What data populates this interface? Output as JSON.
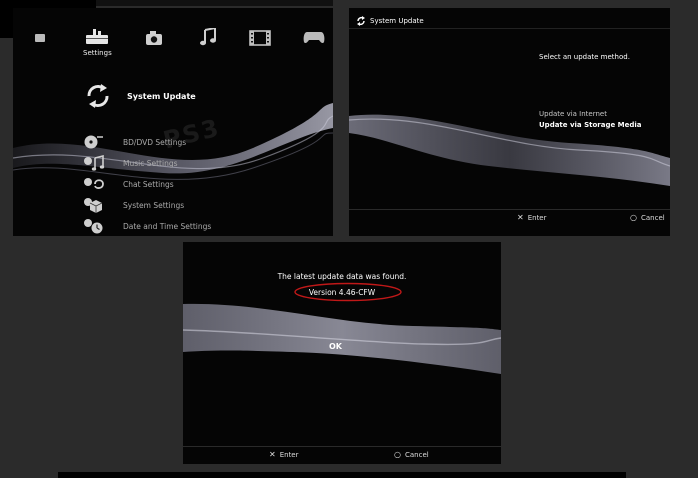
{
  "xmb": {
    "category_label": "Settings",
    "items": [
      {
        "label": "System Update",
        "selected": true
      },
      {
        "label": "BD/DVD Settings"
      },
      {
        "label": "Music Settings"
      },
      {
        "label": "Chat Settings"
      },
      {
        "label": "System Settings"
      },
      {
        "label": "Date and Time Settings"
      }
    ],
    "watermark": "PS3"
  },
  "update_method": {
    "header": "System Update",
    "prompt": "Select an update method.",
    "options": [
      "Update via Internet",
      "Update via Storage Media"
    ],
    "selected_index": 1,
    "enter_label": "Enter",
    "cancel_label": "Cancel"
  },
  "update_found": {
    "message": "The latest update data was found.",
    "version": "Version 4.46-CFW",
    "ok_label": "OK",
    "enter_label": "Enter",
    "cancel_label": "Cancel",
    "highlight_color": "#c01818"
  },
  "icons": {
    "categories": [
      "users-icon",
      "settings-toolbox-icon",
      "camera-icon",
      "music-icon",
      "video-icon",
      "gamepad-icon"
    ],
    "item_icons": [
      "system-update-icon",
      "disc-icon",
      "music-note-icon",
      "chat-icon",
      "system-settings-icon",
      "clock-icon"
    ]
  }
}
